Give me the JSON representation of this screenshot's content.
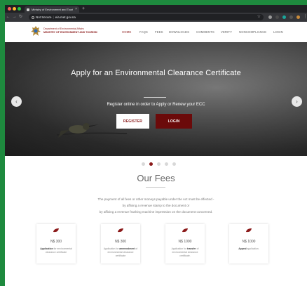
{
  "browser": {
    "tab_title": "Ministry of Environment and Tourism",
    "tab_close": "×",
    "new_tab": "+",
    "security_label": "Not Secure",
    "url": "eia.met.gov.na",
    "traffic_colors": [
      "#ff5f57",
      "#febc2e",
      "#28c840"
    ]
  },
  "site": {
    "logo_line1": "Department of Environmental Affairs",
    "logo_line2": "MINISTRY OF ENVIRONMENT AND TOURISM",
    "nav": [
      "HOME",
      "FAQS",
      "FEES",
      "DOWNLOADS",
      "COMMENTS",
      "VERIFY",
      "NONCOMPLIANCE",
      "LOGIN"
    ],
    "active_nav": "HOME"
  },
  "hero": {
    "title": "Apply for an Environmental Clearance Certificate",
    "subtitle": "Register online in order to Apply or Renew your ECC",
    "register_label": "REGISTER",
    "login_label": "LOGIN",
    "prev_icon": "chevron-left-icon",
    "next_icon": "chevron-right-icon"
  },
  "carousel": {
    "slides": 5,
    "active": 1
  },
  "fees": {
    "title": "Our Fees",
    "desc_line1": "The payment of all fees or other moneys payable under the Act must be effected -",
    "desc_line2": "by affixing a revenue stamp to the document or",
    "desc_line3": "by affixing a revenue franking machine impression on the document concerned.",
    "cards": [
      {
        "price": "N$ 300",
        "pre": "",
        "bold": "Application",
        "post": " for environmental clearance certificate"
      },
      {
        "price": "N$ 300",
        "pre": "Application for ",
        "bold": "ammendment",
        "post": " of environmental clearance certificate"
      },
      {
        "price": "N$ 1000",
        "pre": "Application for ",
        "bold": "transfer",
        "post": " of environmental clearance certificate."
      },
      {
        "price": "N$ 1000",
        "pre": "",
        "bold": "Appeal",
        "post": " application."
      }
    ]
  },
  "colors": {
    "accent": "#8b1a1a",
    "login_btn": "#6b0a0a",
    "page_bg": "#1e8a3e"
  }
}
